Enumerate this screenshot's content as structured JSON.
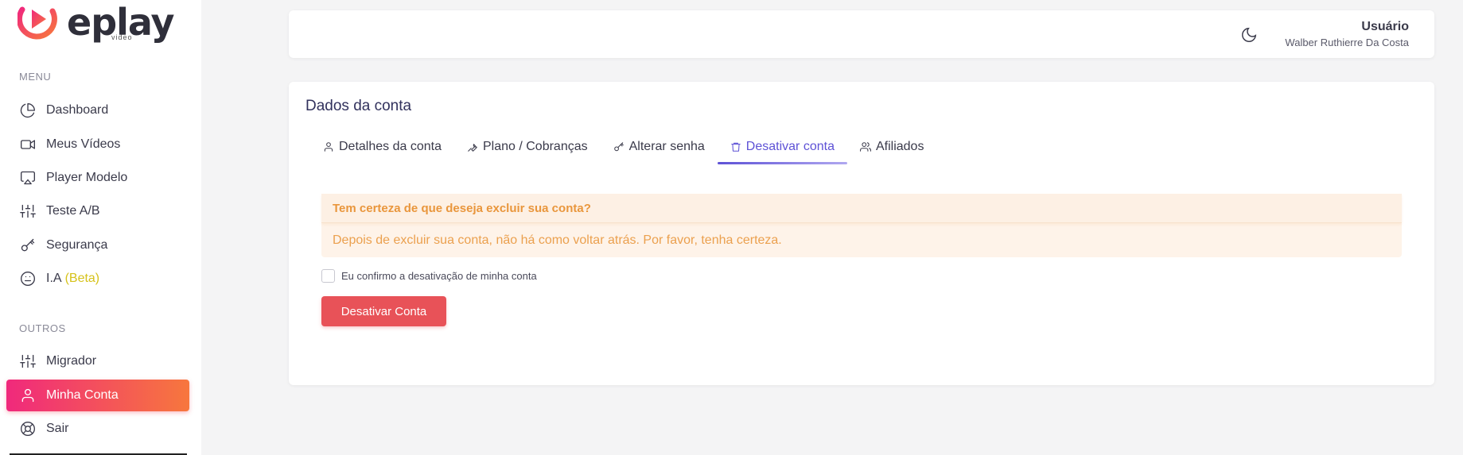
{
  "logo": {
    "word": "eplay",
    "sub": "video"
  },
  "sidebar": {
    "menu_title": "MENU",
    "items": [
      {
        "label": "Dashboard",
        "icon": "pie-chart-icon"
      },
      {
        "label": "Meus Vídeos",
        "icon": "video-camera-icon"
      },
      {
        "label": "Player Modelo",
        "icon": "airplay-icon"
      },
      {
        "label": "Teste A/B",
        "icon": "sliders-icon"
      },
      {
        "label": "Segurança",
        "icon": "key-icon"
      },
      {
        "label": "I.A",
        "badge": "(Beta)",
        "icon": "smile-icon"
      }
    ],
    "other_title": "OUTROS",
    "other_items": [
      {
        "label": "Migrador",
        "icon": "sliders-icon"
      },
      {
        "label": "Minha Conta",
        "icon": "user-icon",
        "active": true
      },
      {
        "label": "Sair",
        "icon": "life-buoy-icon"
      }
    ]
  },
  "header": {
    "user_label": "Usuário",
    "user_name": "Walber Ruthierre Da Costa"
  },
  "main": {
    "title": "Dados da conta",
    "tabs": [
      {
        "label": "Detalhes da conta",
        "icon": "user-icon"
      },
      {
        "label": "Plano / Cobranças",
        "icon": "tool-icon"
      },
      {
        "label": "Alterar senha",
        "icon": "key-icon"
      },
      {
        "label": "Desativar conta",
        "icon": "trash-icon",
        "active": true
      },
      {
        "label": "Afiliados",
        "icon": "users-icon"
      }
    ],
    "alert": {
      "heading": "Tem certeza de que deseja excluir sua conta?",
      "body": "Depois de excluir sua conta, não há como voltar atrás. Por favor, tenha certeza."
    },
    "confirm_label": "Eu confirmo a desativação de minha conta",
    "confirm_checked": false,
    "deactivate_button": "Desativar Conta"
  },
  "colors": {
    "accent": "#5e52d6",
    "active_gradient_start": "#f0297c",
    "active_gradient_end": "#f7773d",
    "danger": "#e85258",
    "warning_text": "#e9963c",
    "beta": "#d6c21a"
  }
}
